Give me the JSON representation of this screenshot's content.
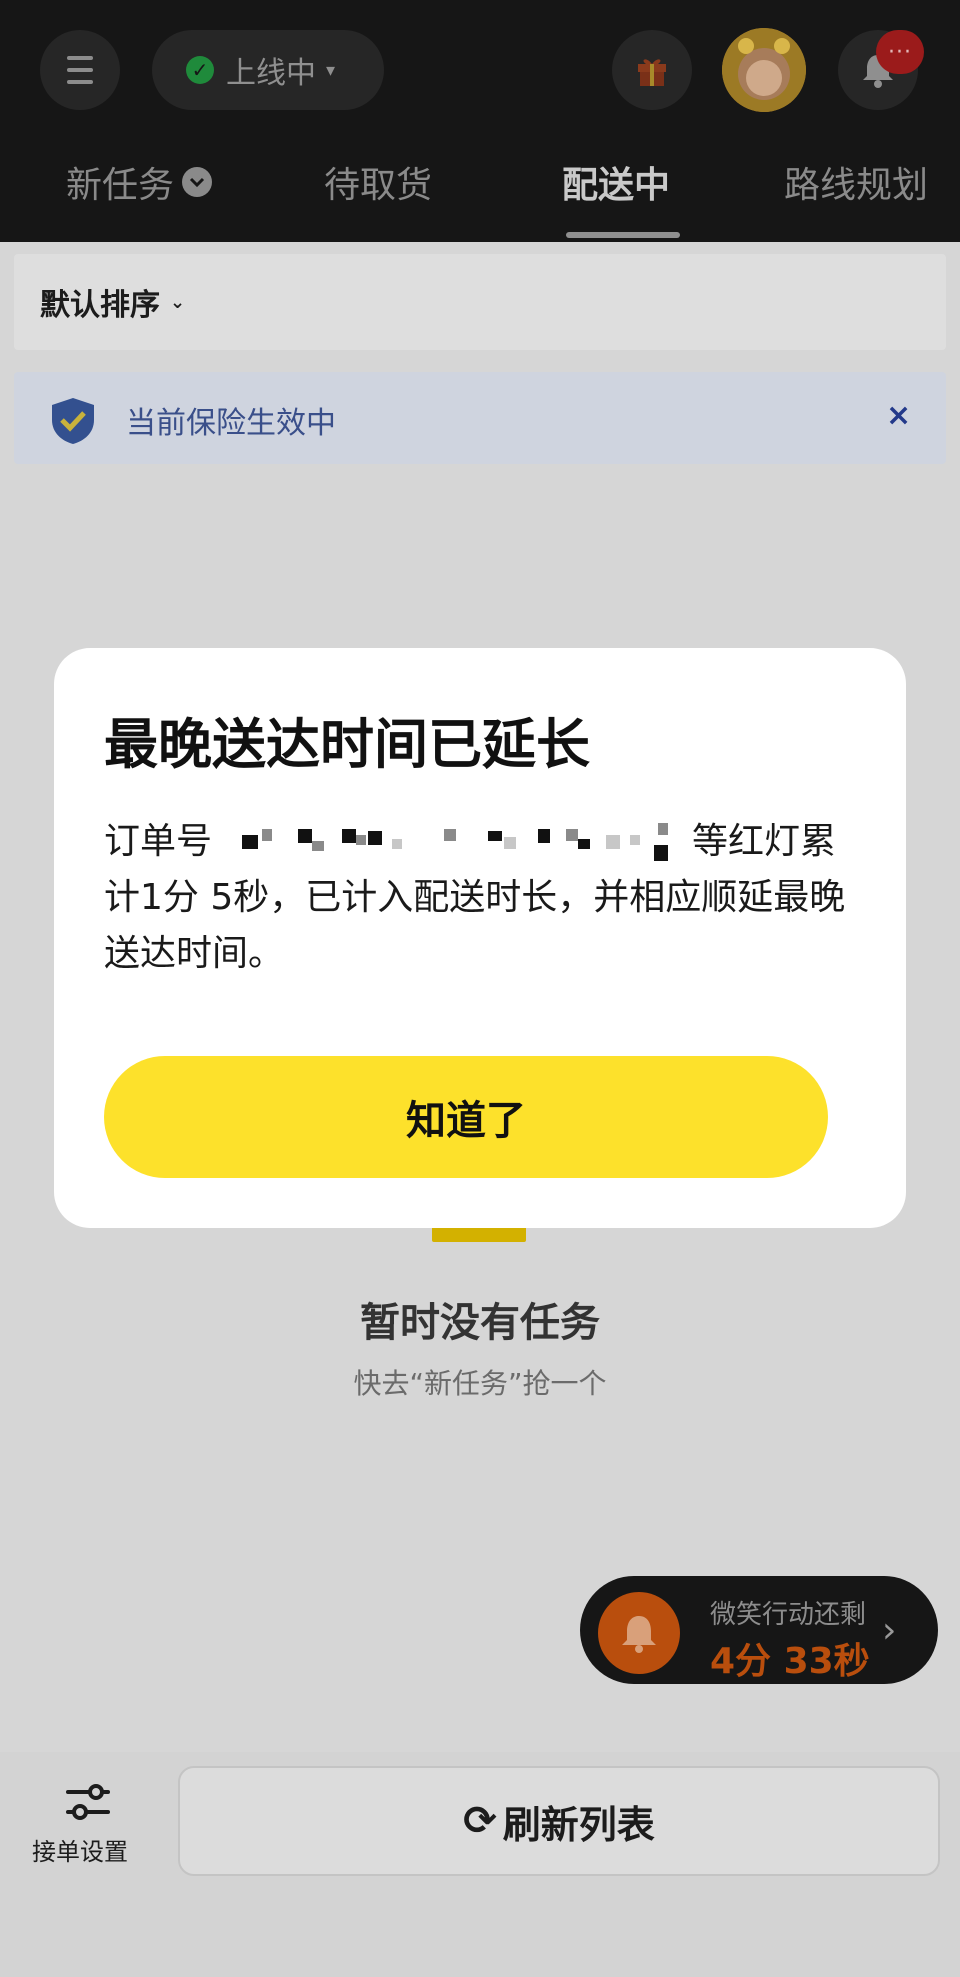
{
  "header": {
    "status_label": "上线中",
    "tabs": [
      {
        "label": "新任务"
      },
      {
        "label": "待取货"
      },
      {
        "label": "配送中"
      },
      {
        "label": "路线规划"
      }
    ],
    "active_tab": "配送中",
    "notification_badge": "···"
  },
  "sort": {
    "label": "默认排序"
  },
  "insurance": {
    "text": "当前保险生效中",
    "close": "×"
  },
  "empty_state": {
    "title": "暂时没有任务",
    "subtitle": "快去“新任务”抢一个"
  },
  "timer": {
    "label": "微笑行动还剩",
    "value": "4分 33秒",
    "arrow": "›"
  },
  "bottom": {
    "settings_label": "接单设置",
    "refresh_label": "刷新列表"
  },
  "modal": {
    "title": "最晚送达时间已延长",
    "body_prefix": "订单号",
    "body_suffix": "等红灯累计1分 5秒，已计入配送时长，并相应顺延最晚送达时间。",
    "button_label": "知道了"
  },
  "colors": {
    "header_bg": "#161616",
    "button_yellow": "#fde12b",
    "status_green": "#1f8a3b",
    "timer_orange": "#b94e0d",
    "insurance_blue": "#3a4f8a"
  }
}
